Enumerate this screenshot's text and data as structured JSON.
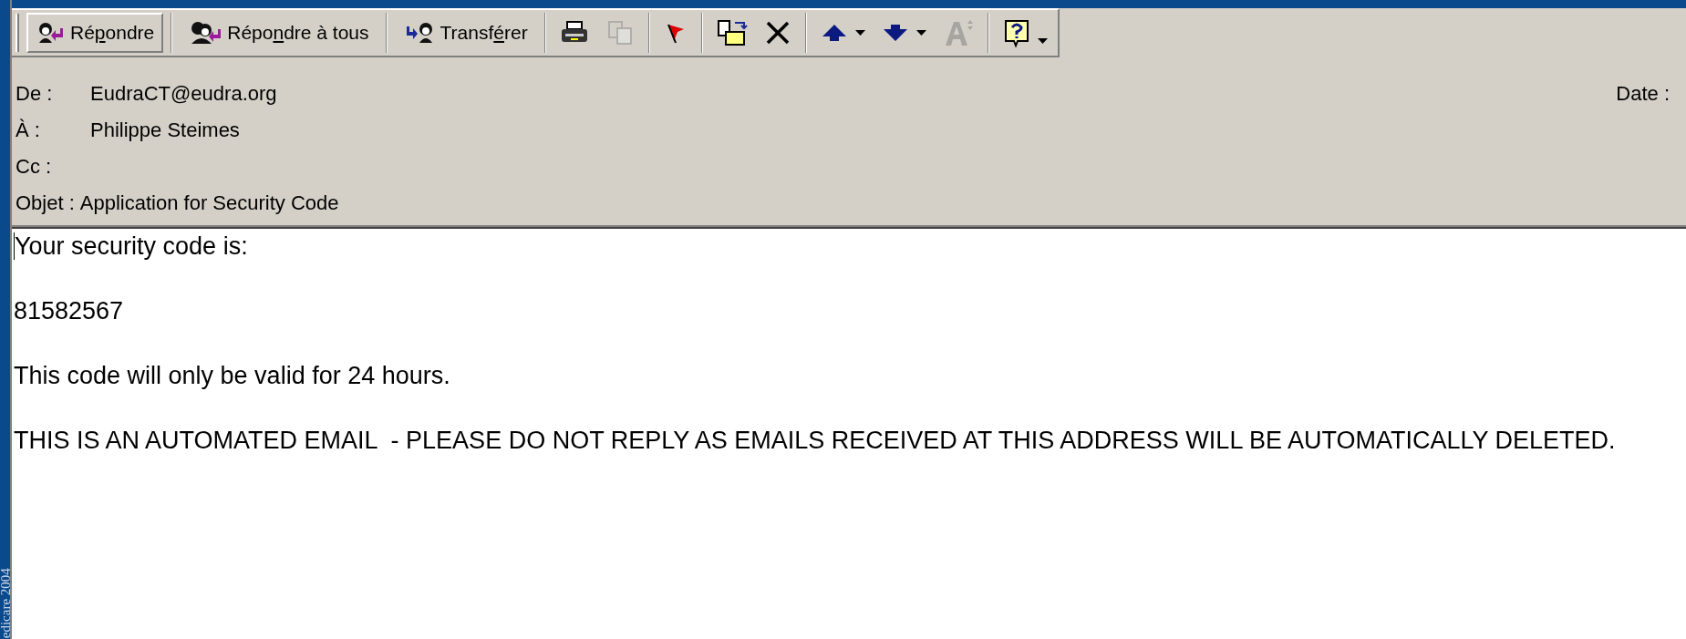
{
  "side_caption": "edicare 2004",
  "toolbar": [
    {
      "kind": "text_button",
      "label": {
        "pre": "Ré",
        "key": "p",
        "post": "ondre"
      },
      "selected": true
    },
    {
      "kind": "separator"
    },
    {
      "kind": "text_button",
      "label": {
        "pre": "Répo",
        "key": "n",
        "post": "dre à tous"
      },
      "selected": false
    },
    {
      "kind": "separator"
    },
    {
      "kind": "text_button",
      "label": {
        "pre": "Transf",
        "key": "é",
        "post": "rer"
      },
      "selected": false
    },
    {
      "kind": "separator"
    },
    {
      "kind": "icon_button",
      "disabled": false
    },
    {
      "kind": "icon_button",
      "disabled": true
    },
    {
      "kind": "separator"
    },
    {
      "kind": "icon_button",
      "disabled": false
    },
    {
      "kind": "separator"
    },
    {
      "kind": "icon_button",
      "disabled": false
    },
    {
      "kind": "icon_button",
      "disabled": false
    },
    {
      "kind": "separator"
    },
    {
      "kind": "icon_button",
      "disabled": false,
      "dropdown": true
    },
    {
      "kind": "icon_button",
      "disabled": false,
      "dropdown": true
    },
    {
      "kind": "icon_button",
      "disabled": true
    },
    {
      "kind": "separator"
    },
    {
      "kind": "icon_button",
      "disabled": false,
      "dropdown": true
    }
  ],
  "header": {
    "fields": [
      {
        "label": "De :",
        "value": "EudraCT@eudra.org"
      },
      {
        "label": "À :",
        "value": "Philippe Steimes"
      },
      {
        "label": "Cc :"
      },
      {
        "label": "Objet :",
        "value": "Application for Security Code"
      }
    ],
    "date_label": "Date :"
  },
  "body": [
    "Your security code is:",
    "81582567",
    "This code will only be valid for 24 hours.",
    "THIS IS AN AUTOMATED EMAIL  - PLEASE DO NOT REPLY AS EMAILS RECEIVED AT THIS ADDRESS WILL BE AUTOMATICALLY DELETED."
  ]
}
